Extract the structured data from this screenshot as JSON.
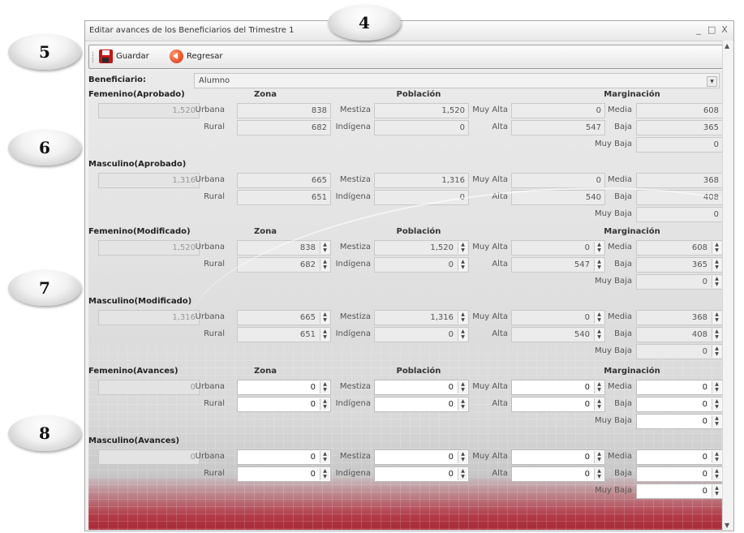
{
  "callouts": [
    "4",
    "5",
    "6",
    "7",
    "8"
  ],
  "window": {
    "title": "Editar avances de los Beneficiarios del Trimestre 1",
    "minimize": "_",
    "maximize": "□",
    "close": "X"
  },
  "toolbar": {
    "save_label": "Guardar",
    "back_label": "Regresar"
  },
  "beneficiario": {
    "label": "Beneficiario:",
    "value": "Alumno"
  },
  "labels": {
    "zona": "Zona",
    "poblacion": "Población",
    "marginacion": "Marginación",
    "urbana": "Urbana",
    "rural": "Rural",
    "mestiza": "Mestiza",
    "indigena": "Indígena",
    "muy_alta": "Muy Alta",
    "alta": "Alta",
    "media": "Media",
    "baja": "Baja",
    "muy_baja": "Muy Baja"
  },
  "sections": [
    {
      "female_title": "Femenino(Aprobado)",
      "male_title": "Masculino(Aprobado)",
      "female": {
        "total": "1,520",
        "urbana": "838",
        "rural": "682",
        "mestiza": "1,520",
        "indigena": "0",
        "muy_alta": "0",
        "alta": "547",
        "media": "608",
        "baja": "365",
        "muy_baja": "0"
      },
      "male": {
        "total": "1,316",
        "urbana": "665",
        "rural": "651",
        "mestiza": "1,316",
        "indigena": "0",
        "muy_alta": "0",
        "alta": "540",
        "media": "368",
        "baja": "408",
        "muy_baja": "0"
      }
    },
    {
      "female_title": "Femenino(Modificado)",
      "male_title": "Masculino(Modificado)",
      "female": {
        "total": "1,520",
        "urbana": "838",
        "rural": "682",
        "mestiza": "1,520",
        "indigena": "0",
        "muy_alta": "0",
        "alta": "547",
        "media": "608",
        "baja": "365",
        "muy_baja": "0"
      },
      "male": {
        "total": "1,316",
        "urbana": "665",
        "rural": "651",
        "mestiza": "1,316",
        "indigena": "0",
        "muy_alta": "0",
        "alta": "540",
        "media": "368",
        "baja": "408",
        "muy_baja": "0"
      }
    },
    {
      "female_title": "Femenino(Avances)",
      "male_title": "Masculino(Avances)",
      "female": {
        "total": "0",
        "urbana": "0",
        "rural": "0",
        "mestiza": "0",
        "indigena": "0",
        "muy_alta": "0",
        "alta": "0",
        "media": "0",
        "baja": "0",
        "muy_baja": "0"
      },
      "male": {
        "total": "0",
        "urbana": "0",
        "rural": "0",
        "mestiza": "0",
        "indigena": "0",
        "muy_alta": "0",
        "alta": "0",
        "media": "0",
        "baja": "0",
        "muy_baja": "0"
      }
    }
  ],
  "colors": {
    "accent_red": "#b23a48",
    "panel_gray": "#e2e2e2",
    "border": "#a8a8a8"
  },
  "icons": {
    "save": "floppy-disk-icon",
    "back": "back-arrow-icon",
    "dropdown": "chevron-down-icon",
    "spin": "spin-arrows-icon"
  }
}
